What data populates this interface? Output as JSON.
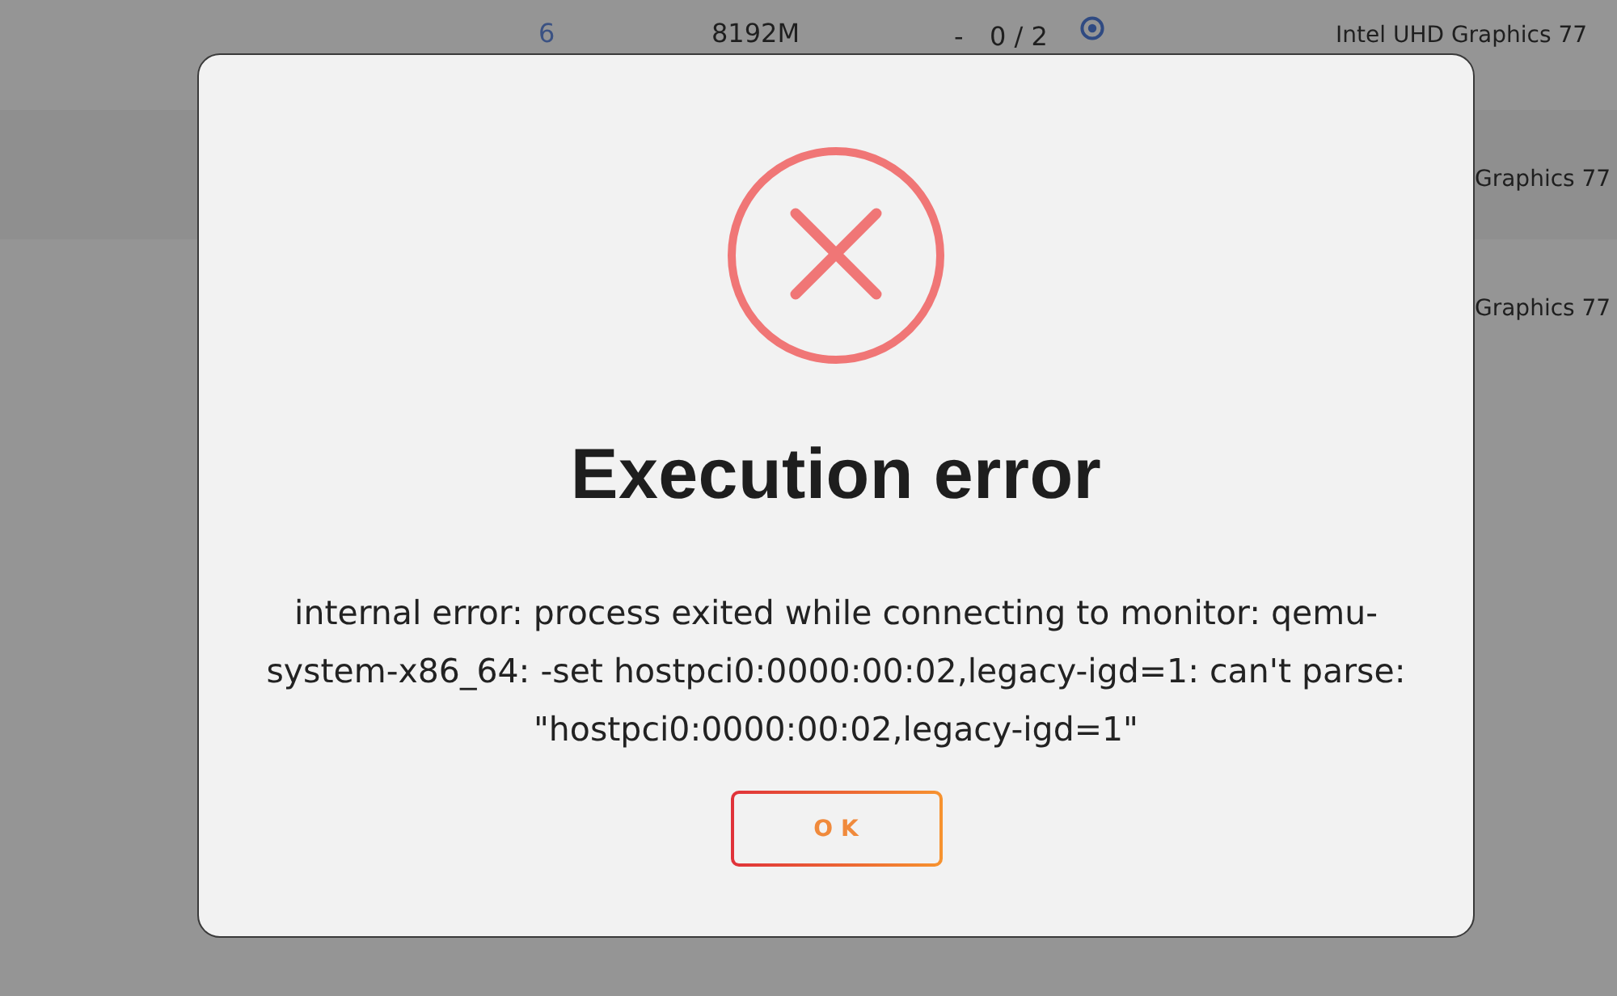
{
  "background_table": {
    "rows": [
      {
        "column_1": "6",
        "column_2": "8192M",
        "column_3": "-",
        "column_4": "0 / 2",
        "column_5": "Intel UHD Graphics 77"
      },
      {
        "column_5": "Graphics 77"
      },
      {
        "column_5": "Graphics 77"
      }
    ]
  },
  "dialog": {
    "title": "Execution error",
    "message": "internal error: process exited while connecting to monitor: qemu-system-x86_64: -set hostpci0:0000:00:02,legacy-igd=1: can't parse: \"hostpci0:0000:00:02,legacy-igd=1\"",
    "buttons": [
      "OK"
    ]
  }
}
